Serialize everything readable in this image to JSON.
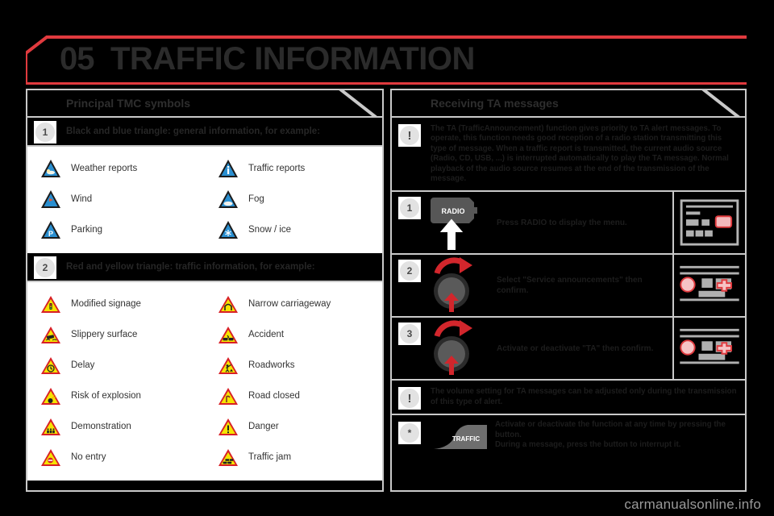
{
  "chapter": {
    "number": "05",
    "title": "TRAFFIC INFORMATION"
  },
  "left_panel": {
    "section_title": "Principal TMC symbols",
    "groups": [
      {
        "badge": "1",
        "title": "Black and blue triangle: general information, for example:",
        "items": [
          {
            "label": "Weather reports",
            "icon": "blue-triangle-weather-icon"
          },
          {
            "label": "Traffic reports",
            "icon": "blue-triangle-info-icon"
          },
          {
            "label": "Wind",
            "icon": "blue-triangle-wind-icon"
          },
          {
            "label": "Fog",
            "icon": "blue-triangle-fog-icon"
          },
          {
            "label": "Parking",
            "icon": "blue-triangle-parking-icon"
          },
          {
            "label": "Snow / ice",
            "icon": "blue-triangle-snow-icon"
          }
        ]
      },
      {
        "badge": "2",
        "title": "Red and yellow triangle: traffic information, for example:",
        "items": [
          {
            "label": "Modified signage",
            "icon": "yellow-triangle-signage-icon"
          },
          {
            "label": "Narrow carriageway",
            "icon": "yellow-triangle-narrow-icon"
          },
          {
            "label": "Slippery surface",
            "icon": "yellow-triangle-slippery-icon"
          },
          {
            "label": "Accident",
            "icon": "yellow-triangle-accident-icon"
          },
          {
            "label": "Delay",
            "icon": "yellow-triangle-delay-icon"
          },
          {
            "label": "Roadworks",
            "icon": "yellow-triangle-roadworks-icon"
          },
          {
            "label": "Risk of explosion",
            "icon": "yellow-triangle-explosion-icon"
          },
          {
            "label": "Road closed",
            "icon": "yellow-triangle-closed-icon"
          },
          {
            "label": "Demonstration",
            "icon": "yellow-triangle-demonstration-icon"
          },
          {
            "label": "Danger",
            "icon": "yellow-triangle-danger-icon"
          },
          {
            "label": "No entry",
            "icon": "yellow-triangle-noentry-icon"
          },
          {
            "label": "Traffic jam",
            "icon": "yellow-triangle-jam-icon"
          }
        ]
      }
    ]
  },
  "right_panel": {
    "section_title": "Receiving TA messages",
    "intro_note": {
      "badge": "!",
      "text": "The TA (TrafficAnnouncement) function gives priority to TA alert messages. To operate, this function needs good reception of a radio station transmitting this type of message. When a traffic report is transmitted, the current audio source (Radio, CD, USB, ...) is interrupted automatically to play the TA message. Normal playback of the audio source resumes at the end of the transmission of the message."
    },
    "steps": [
      {
        "badge": "1",
        "text": "Press RADIO to display the menu.",
        "control": "radio-button",
        "control_label": "RADIO"
      },
      {
        "badge": "2",
        "text": "Select \"Service announcements\" then confirm.",
        "control": "rotary-knob"
      },
      {
        "badge": "3",
        "text": "Activate or deactivate \"TA\" then confirm.",
        "control": "rotary-knob"
      }
    ],
    "volume_note": {
      "badge": "!",
      "text": "The volume setting for TA messages can be adjusted only during the transmission of this type of alert."
    },
    "traffic_note": {
      "badge": "*",
      "button_label": "TRAFFIC",
      "line1": "Activate or deactivate the function at any time by pressing the button.",
      "line2": "During a message, press the button to interrupt it."
    }
  },
  "footer": {
    "watermark": "carmanualsonline.info"
  },
  "colors": {
    "accent_red": "#e03a3e",
    "panel_border": "#c9c9c9",
    "background": "#000000",
    "text_dark": "#2b2b2b",
    "sign_blue": "#2a8fd0",
    "sign_yellow": "#f5e400"
  }
}
